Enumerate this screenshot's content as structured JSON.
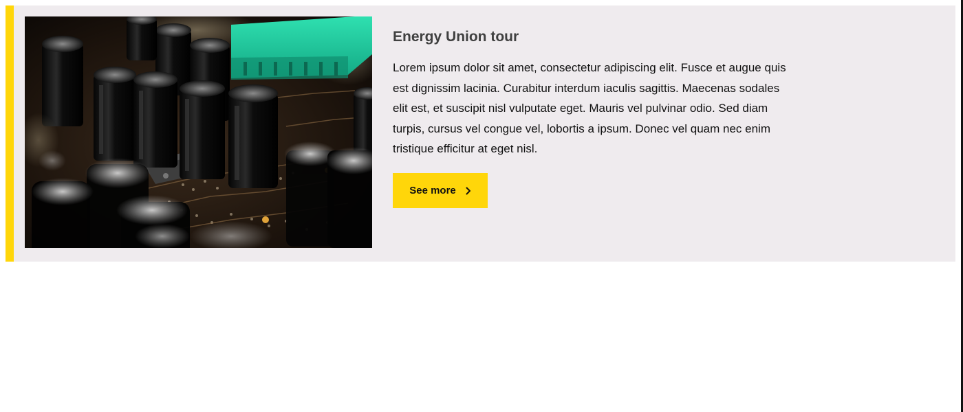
{
  "card": {
    "title": "Energy Union tour",
    "body": "Lorem ipsum dolor sit amet, consectetur adipiscing elit. Fusce et augue quis est dignissim lacinia. Curabitur interdum iaculis sagittis. Maecenas sodales elit est, et suscipit nisl vulputate eget. Mauris vel pulvinar odio. Sed diam turpis, cursus vel congue vel, lobortis a ipsum. Donec vel quam nec enim tristique efficitur at eget nisl.",
    "button_label": "See more",
    "button_icon": "chevron-right-icon"
  },
  "colors": {
    "accent": "#ffd60a",
    "card_background": "#efebee",
    "title": "#404040",
    "text": "#111111"
  }
}
